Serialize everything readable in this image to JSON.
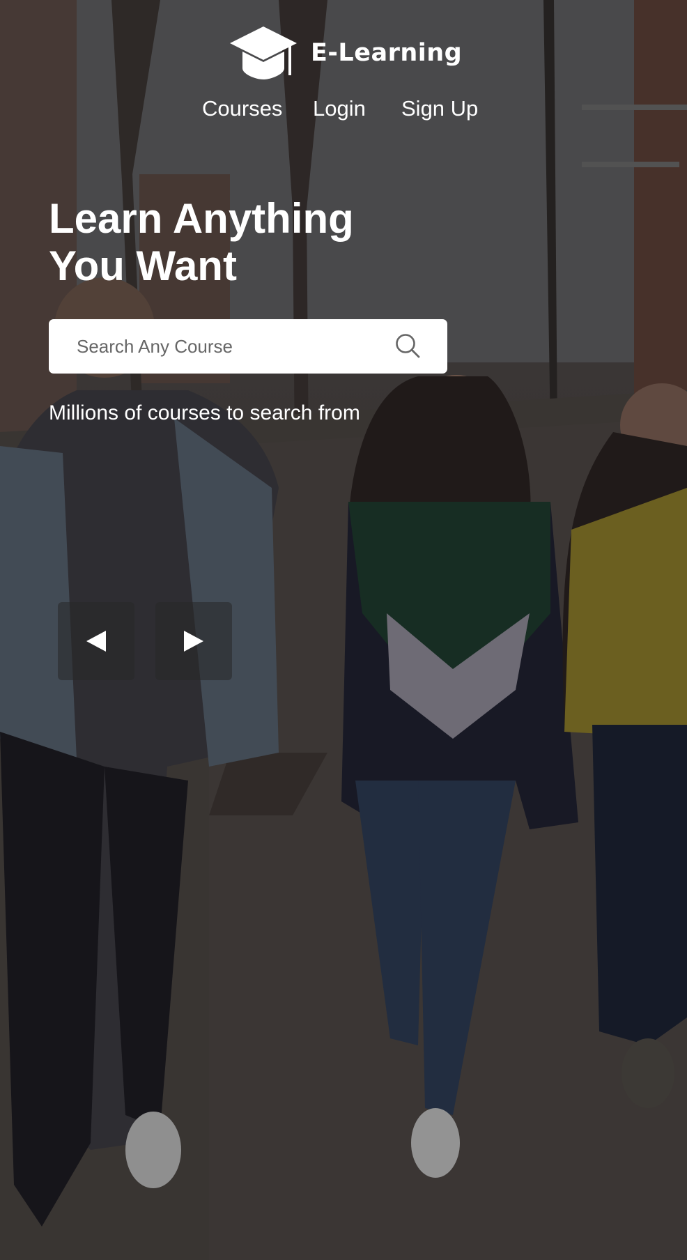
{
  "brand": {
    "name": "E-Learning",
    "icon": "graduation-cap-icon"
  },
  "nav": {
    "items": [
      {
        "label": "Courses"
      },
      {
        "label": "Login"
      },
      {
        "label": "Sign Up"
      }
    ]
  },
  "hero": {
    "headline_line1": "Learn Anything",
    "headline_line2": "You Want",
    "search_placeholder": "Search Any Course",
    "search_icon": "search-icon",
    "subtitle": "Millions of courses to search from",
    "prev_icon": "triangle-left-icon",
    "next_icon": "triangle-right-icon"
  },
  "colors": {
    "text": "#ffffff",
    "search_bg": "#ffffff",
    "placeholder": "#666666",
    "control_bg": "#282828"
  }
}
